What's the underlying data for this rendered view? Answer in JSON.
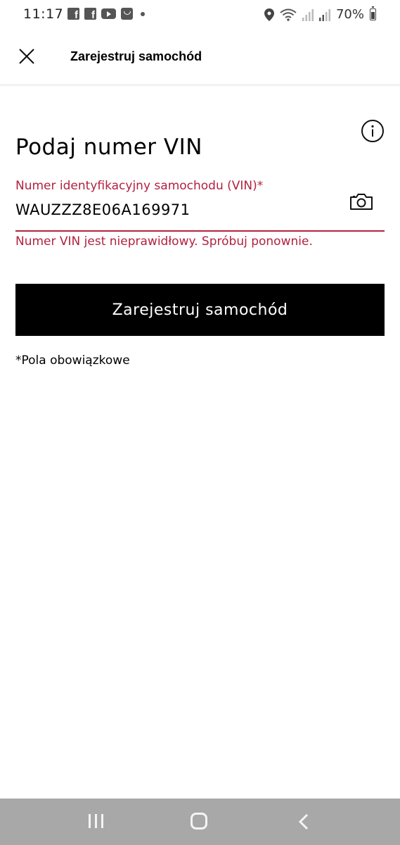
{
  "status_bar": {
    "time": "11:17",
    "battery": "70%",
    "icons": [
      "facebook-icon",
      "facebook-icon",
      "youtube-icon",
      "shopping-bag-icon",
      "notification-dot-icon",
      "location-icon",
      "wifi-icon",
      "signal-icon",
      "signal-icon",
      "battery-icon"
    ]
  },
  "header": {
    "title": "Zarejestruj samochód",
    "close_icon": "close-icon"
  },
  "main": {
    "title": "Podaj numer VIN",
    "info_icon": "info-icon",
    "vin_field": {
      "label": "Numer identyfikacyjny samochodu (VIN)*",
      "value": "WAUZZZ8E06A169971",
      "error": "Numer VIN jest nieprawidłowy. Spróbuj ponownie.",
      "camera_icon": "camera-icon"
    },
    "submit_label": "Zarejestruj samochód",
    "required_note": "*Pola obowiązkowe"
  },
  "nav_bar": {
    "icons": [
      "recent-apps-icon",
      "home-icon",
      "back-icon"
    ]
  },
  "colors": {
    "error": "#b3213f",
    "button_bg": "#000000",
    "nav_bg": "#a8a8a8"
  }
}
